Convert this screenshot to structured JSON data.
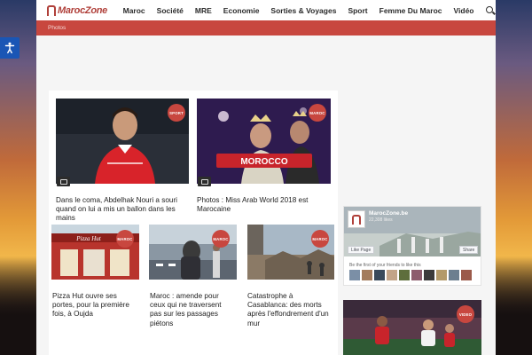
{
  "header": {
    "logo": "MarocZone",
    "nav": [
      "Maroc",
      "Société",
      "MRE",
      "Economie",
      "Sorties & Voyages",
      "Sport",
      "Femme Du Maroc",
      "Vidéo"
    ]
  },
  "breadcrumb": {
    "current": "Photos"
  },
  "articles": [
    {
      "title": "Dans le coma, Abdelhak Nouri a souri quand on lui a mis un ballon dans les mains",
      "category": "SPORT"
    },
    {
      "title": "Photos : Miss Arab World 2018 est Marocaine",
      "category": "MAROC",
      "banner": "MOROCCO"
    },
    {
      "title": "Pizza Hut ouvre ses portes, pour la première fois, à Oujda",
      "category": "MAROC",
      "sign": "Pizza Hut"
    },
    {
      "title": "Maroc : amende pour ceux qui ne traversent pas sur les passages piétons",
      "category": "MAROC"
    },
    {
      "title": "Catastrophe à Casablanca: des morts après l'effondrement d'un mur",
      "category": "MAROC"
    }
  ],
  "sidebar": {
    "facebook": {
      "page_name": "MarocZone.be",
      "likes": "22,308 likes",
      "like_label": "Like Page",
      "share_label": "Share",
      "friends_text": "Be the first of your friends to like this"
    },
    "video_badge": "VIDEO"
  },
  "colors": {
    "accent": "#c8473f",
    "nav_text": "#2b2b2b",
    "accessibility": "#1a56b5"
  }
}
